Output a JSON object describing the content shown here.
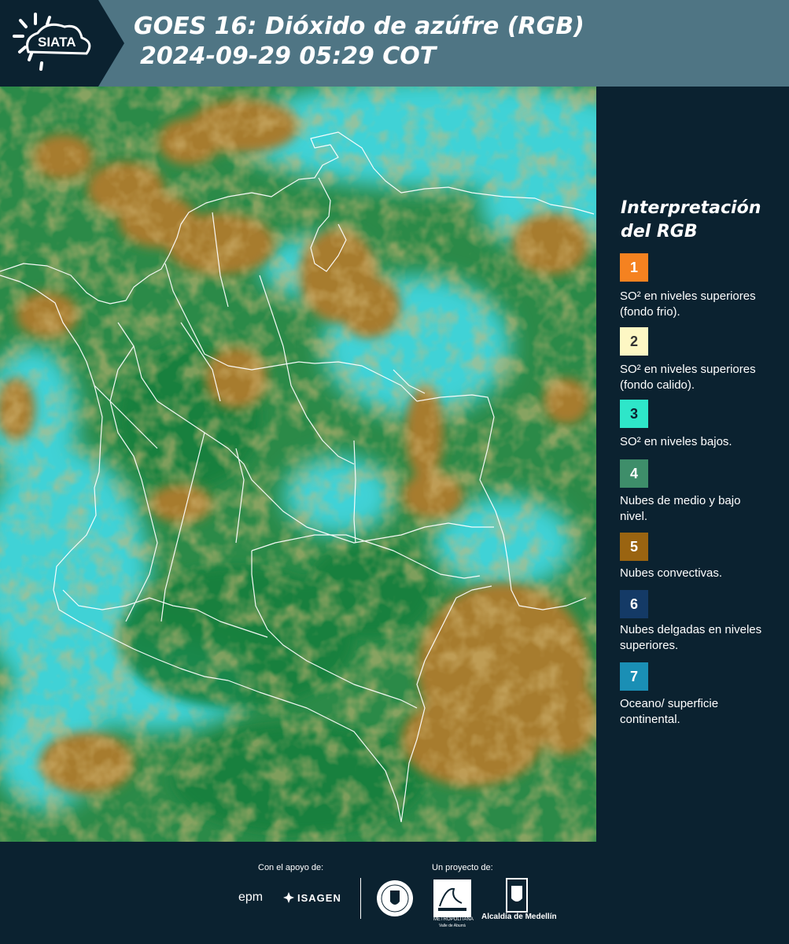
{
  "header": {
    "logo_text": "SIATA",
    "title_line1": "GOES 16: Dióxido de azúfre (RGB)",
    "title_line2": "2024-09-29 05:29 COT",
    "bg_color": "#4f7584"
  },
  "map": {
    "product": "SO2 RGB false-color satellite composite",
    "colors": {
      "cloud": "#a77b2e",
      "low": "#1e8a45",
      "ocean": "#34cfd8",
      "border": "#ffffff"
    }
  },
  "legend": {
    "title": "Interpretación del RGB",
    "items": [
      {
        "number": "1",
        "color": "#f58220",
        "text_color": "#ffffff",
        "label": "SO² en niveles superiores (fondo frio)."
      },
      {
        "number": "2",
        "color": "#fdf7c4",
        "text_color": "#333333",
        "label": "SO² en niveles superiores (fondo calido)."
      },
      {
        "number": "3",
        "color": "#2ee6c9",
        "text_color": "#0b2230",
        "label": "SO² en niveles bajos."
      },
      {
        "number": "4",
        "color": "#3e8e6a",
        "text_color": "#ffffff",
        "label": "Nubes de medio y bajo nivel."
      },
      {
        "number": "5",
        "color": "#9a6411",
        "text_color": "#ffffff",
        "label": "Nubes convectivas."
      },
      {
        "number": "6",
        "color": "#143a66",
        "text_color": "#ffffff",
        "label": "Nubes delgadas en niveles superiores."
      },
      {
        "number": "7",
        "color": "#1a8fb5",
        "text_color": "#ffffff",
        "label": "Oceano/ superficie continental."
      }
    ]
  },
  "footer": {
    "support_label": "Con el apoyo de:",
    "project_label": "Un proyecto de:",
    "sponsors": [
      "epm",
      "ISAGEN"
    ],
    "partners": [
      "METROPOLITANA",
      "Valle de Aburrá",
      "Alcaldía de Medellín"
    ]
  }
}
